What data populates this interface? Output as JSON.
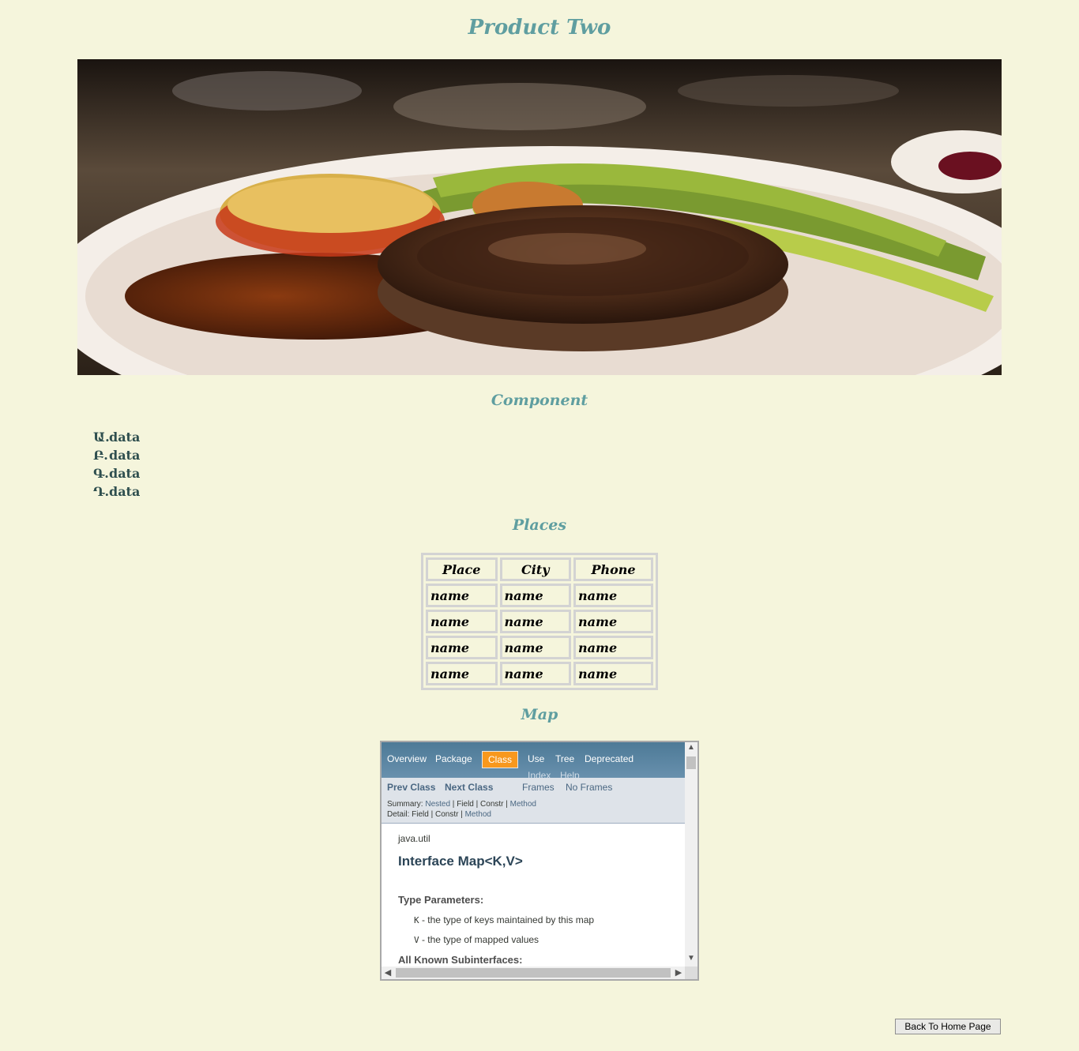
{
  "page": {
    "title": "Product Two",
    "component_heading": "Component",
    "places_heading": "Places",
    "map_heading": "Map",
    "back_button": "Back To Home Page"
  },
  "component_list": [
    {
      "marker": "Ա.",
      "text": "data"
    },
    {
      "marker": "Բ.",
      "text": "data"
    },
    {
      "marker": "Գ.",
      "text": "data"
    },
    {
      "marker": "Դ.",
      "text": "data"
    }
  ],
  "places_table": {
    "headers": [
      "Place",
      "City",
      "Phone"
    ],
    "rows": [
      [
        "name",
        "name",
        "name"
      ],
      [
        "name",
        "name",
        "name"
      ],
      [
        "name",
        "name",
        "name"
      ],
      [
        "name",
        "name",
        "name"
      ]
    ]
  },
  "javadoc_frame": {
    "nav": {
      "overview": "Overview",
      "package": "Package",
      "class": "Class",
      "use": "Use",
      "tree": "Tree",
      "deprecated": "Deprecated",
      "index": "Index",
      "help": "Help"
    },
    "subnav": {
      "prev_class": "Prev Class",
      "next_class": "Next Class",
      "frames": "Frames",
      "no_frames": "No Frames",
      "summary_label": "Summary:",
      "summary_nested": "Nested",
      "summary_field": "Field",
      "summary_constr": "Constr",
      "summary_method": "Method",
      "detail_label": "Detail:",
      "detail_field": "Field",
      "detail_constr": "Constr",
      "detail_method": "Method"
    },
    "doc": {
      "package": "java.util",
      "heading": "Interface Map<K,V>",
      "type_params_label": "Type Parameters:",
      "param_k": "K",
      "param_k_desc": "- the type of keys maintained by this map",
      "param_v": "V",
      "param_v_desc": "- the type of mapped values",
      "subinterfaces_label": "All Known Subinterfaces:"
    }
  },
  "colors": {
    "background": "#f5f5dc",
    "heading": "#5f9ea0",
    "list_text": "#2f4f4f",
    "table_border": "#d3d3d3",
    "javadoc_nav": "#4d7a97",
    "javadoc_active_tab": "#f8981d"
  },
  "icons": [
    "scroll-up-icon",
    "scroll-down-icon",
    "scroll-left-icon",
    "scroll-right-icon"
  ]
}
